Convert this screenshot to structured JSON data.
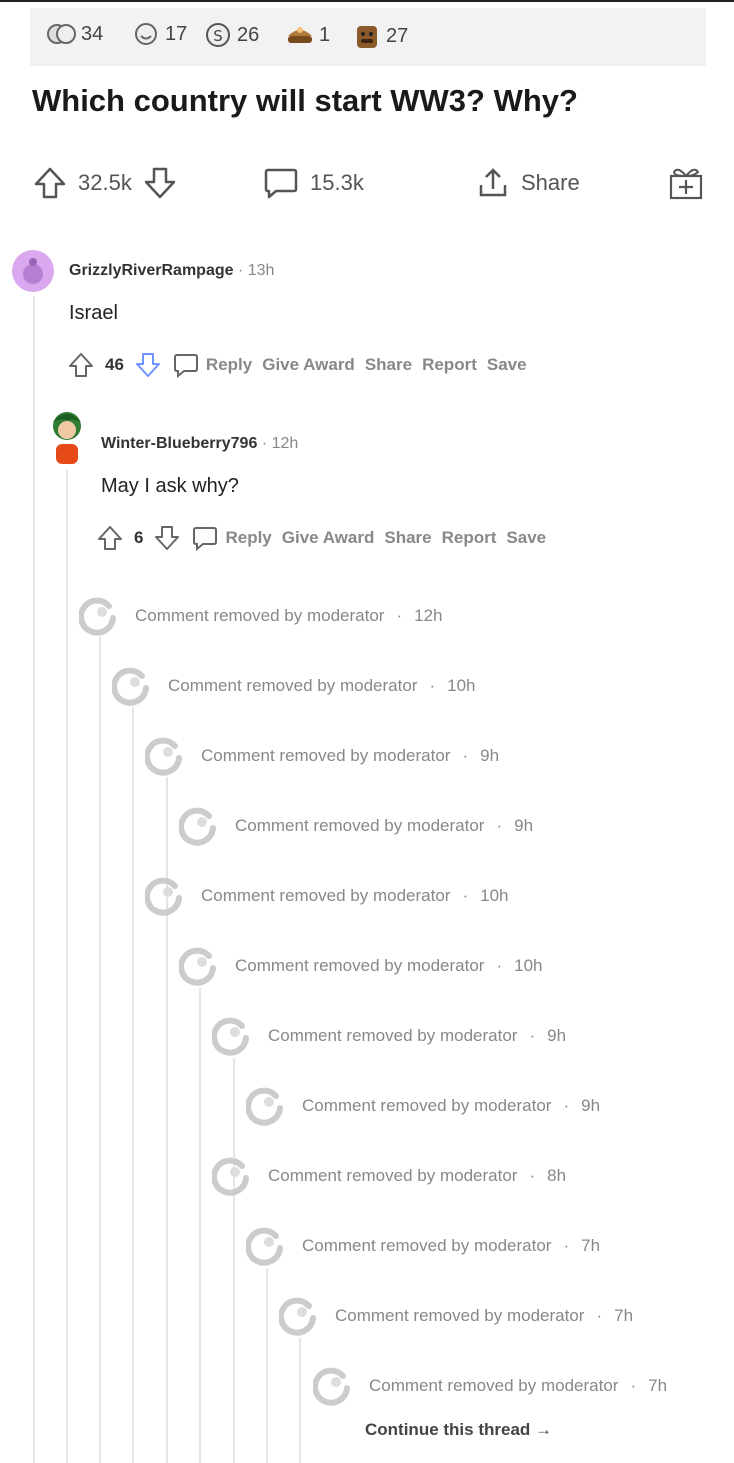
{
  "awards": [
    {
      "icon": "award-faces-icon",
      "count": "34"
    },
    {
      "icon": "award-smile-icon",
      "count": "17"
    },
    {
      "icon": "award-coin-icon",
      "count": "26"
    },
    {
      "icon": "award-bowl-icon",
      "count": "1"
    },
    {
      "icon": "award-bear-icon",
      "count": "27"
    }
  ],
  "post": {
    "title": "Which country will start WW3? Why?",
    "score": "32.5k",
    "comments": "15.3k",
    "share": "Share"
  },
  "comments": [
    {
      "username": "GrizzlyRiverRampage",
      "time": "13h",
      "text": "Israel",
      "score": "46",
      "actions": [
        "Reply",
        "Give Award",
        "Share",
        "Report",
        "Save"
      ]
    },
    {
      "username": "Winter-Blueberry796",
      "time": "12h",
      "text": "May I ask why?",
      "score": "6",
      "actions": [
        "Reply",
        "Give Award",
        "Share",
        "Report",
        "Save"
      ]
    }
  ],
  "removed_label": "Comment removed by moderator",
  "removed": [
    {
      "time": "12h"
    },
    {
      "time": "10h"
    },
    {
      "time": "9h"
    },
    {
      "time": "9h"
    },
    {
      "time": "10h"
    },
    {
      "time": "10h"
    },
    {
      "time": "9h"
    },
    {
      "time": "9h"
    },
    {
      "time": "8h"
    },
    {
      "time": "7h"
    },
    {
      "time": "7h"
    },
    {
      "time": "7h"
    }
  ],
  "separator": "·",
  "continue_label": "Continue this thread →",
  "colors": {
    "accent_down": "#7193ff",
    "removed_gray": "#888888",
    "thread_line": "#e5e5e5"
  }
}
